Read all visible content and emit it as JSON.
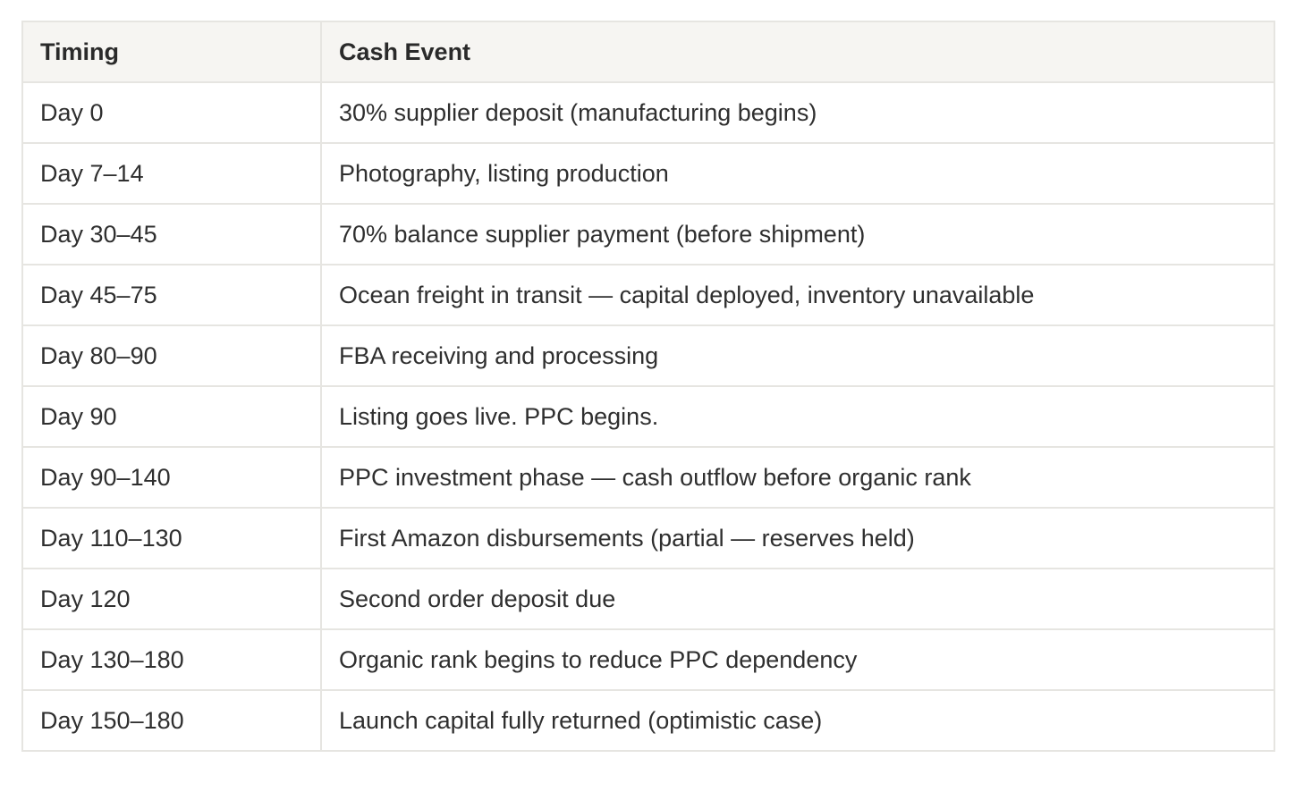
{
  "table": {
    "headers": [
      "Timing",
      "Cash Event"
    ],
    "rows": [
      {
        "timing": "Day 0",
        "event": "30% supplier deposit (manufacturing begins)"
      },
      {
        "timing": "Day 7–14",
        "event": "Photography, listing production"
      },
      {
        "timing": "Day 30–45",
        "event": "70% balance supplier payment (before shipment)"
      },
      {
        "timing": "Day 45–75",
        "event": "Ocean freight in transit — capital deployed, inventory unavailable"
      },
      {
        "timing": "Day 80–90",
        "event": "FBA receiving and processing"
      },
      {
        "timing": "Day 90",
        "event": "Listing goes live. PPC begins."
      },
      {
        "timing": "Day 90–140",
        "event": "PPC investment phase — cash outflow before organic rank"
      },
      {
        "timing": "Day 110–130",
        "event": "First Amazon disbursements (partial — reserves held)"
      },
      {
        "timing": "Day 120",
        "event": "Second order deposit due"
      },
      {
        "timing": "Day 130–180",
        "event": "Organic rank begins to reduce PPC dependency"
      },
      {
        "timing": "Day 150–180",
        "event": "Launch capital fully returned (optimistic case)"
      }
    ]
  }
}
